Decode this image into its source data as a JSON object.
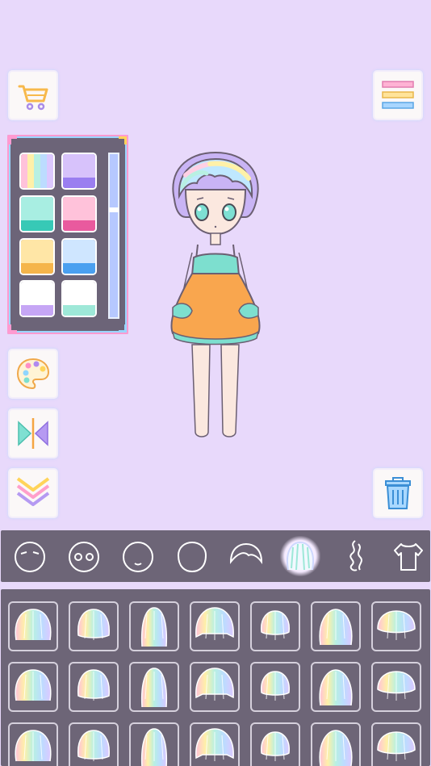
{
  "side_buttons": {
    "cart_icon": "shopping-cart",
    "menu_icon": "striped-menu",
    "palette_icon": "color-palette",
    "flip_icon": "mirror-flip",
    "collapse_icon": "chevron-down",
    "trash_icon": "trash-can"
  },
  "color_panel": {
    "slider_level": 0.33,
    "swatches": [
      {
        "top": "rainbow",
        "bottom": "rainbow"
      },
      {
        "top": "#d7c2fb",
        "bottom": "#9a7ef0"
      },
      {
        "top": "#a8eee2",
        "bottom": "#37c9b6"
      },
      {
        "top": "#ffc2da",
        "bottom": "#e95a9e"
      },
      {
        "top": "#ffe6a6",
        "bottom": "#f5b54b"
      },
      {
        "top": "#cfe6ff",
        "bottom": "#4aa0f0"
      },
      {
        "top": "#ffffff",
        "bottom": "#c6a6f5"
      },
      {
        "top": "#ffffff",
        "bottom": "#9ee8d8"
      }
    ]
  },
  "categories": [
    {
      "name": "eyebrows",
      "selected": false
    },
    {
      "name": "eyes",
      "selected": false
    },
    {
      "name": "mouth",
      "selected": false
    },
    {
      "name": "face",
      "selected": false
    },
    {
      "name": "bangs",
      "selected": false
    },
    {
      "name": "hair",
      "selected": true
    },
    {
      "name": "ponytail",
      "selected": false
    },
    {
      "name": "clothes",
      "selected": false
    }
  ],
  "colors": {
    "background": "#e8d9fb",
    "panel": "#6d6577",
    "dress": "#f9a64e",
    "dress_trim": "#7ddfcf",
    "skin": "#fbe8df"
  }
}
